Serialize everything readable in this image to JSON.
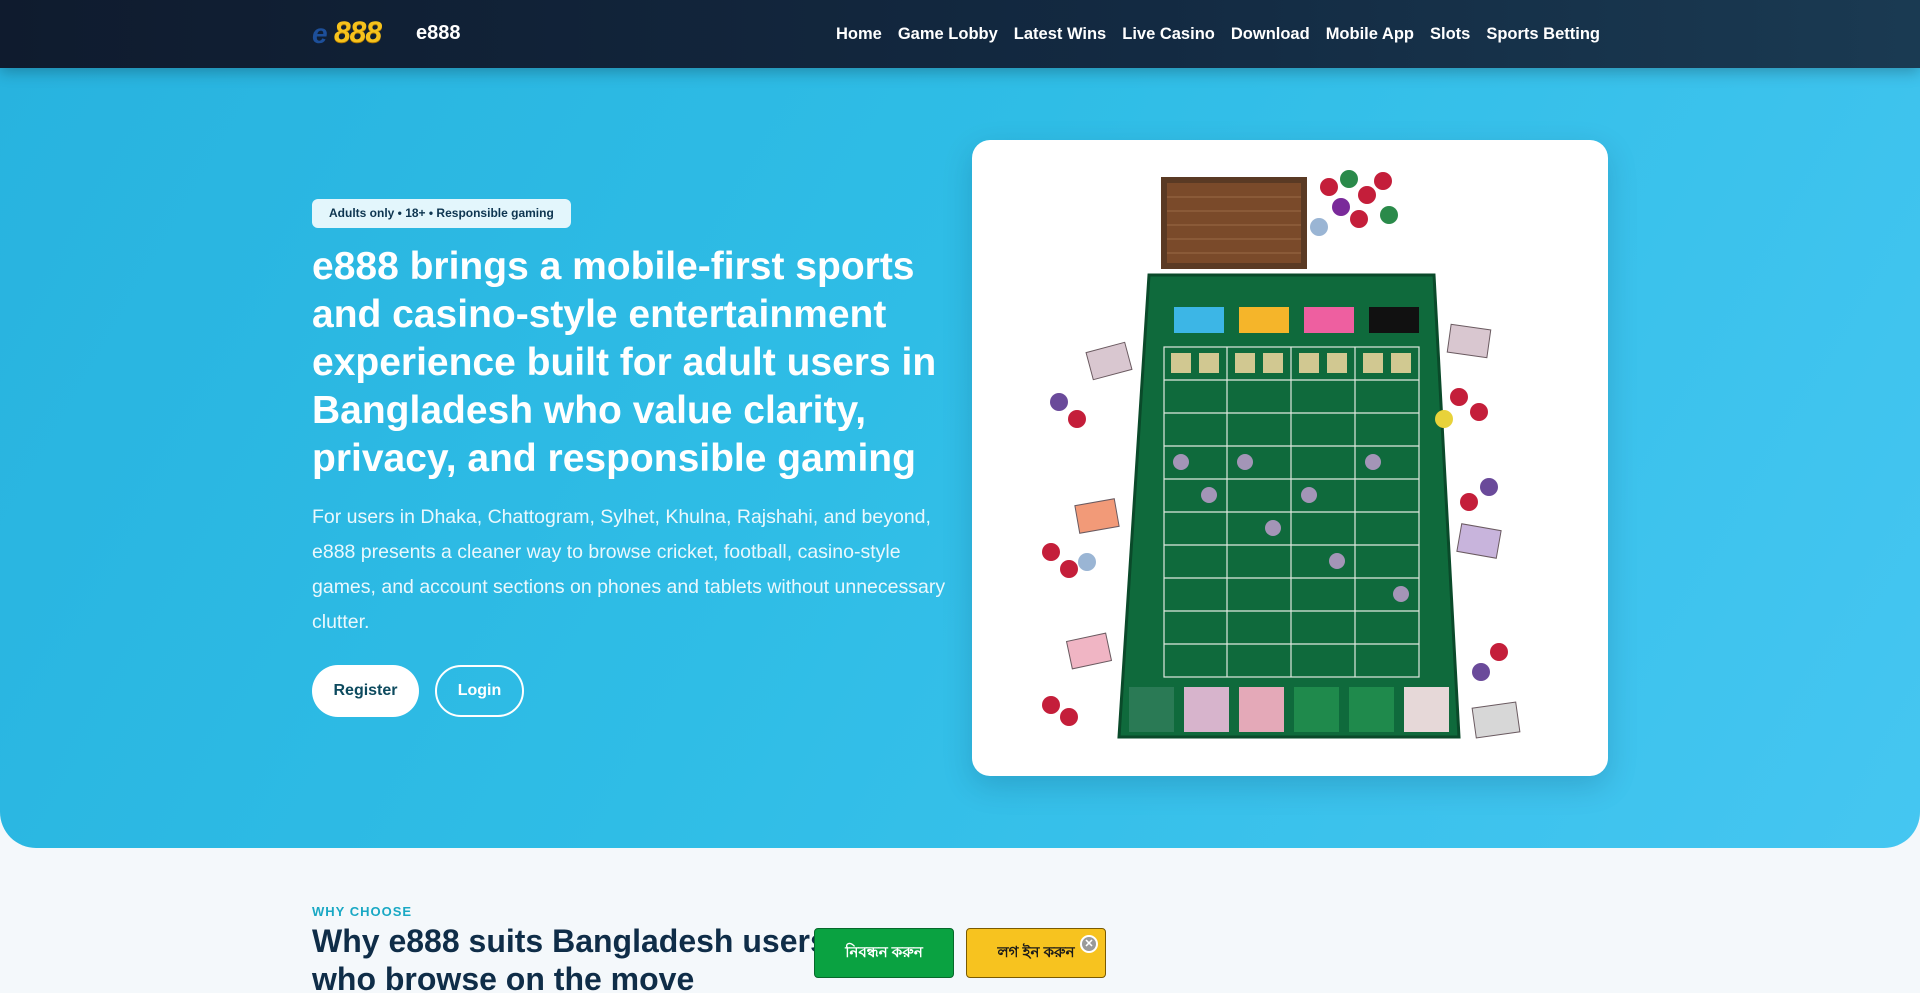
{
  "header": {
    "logo_letter": "e",
    "logo_number": "888",
    "brand_name": "e888",
    "nav": [
      "Home",
      "Game Lobby",
      "Latest Wins",
      "Live Casino",
      "Download",
      "Mobile App",
      "Slots",
      "Sports Betting"
    ]
  },
  "hero": {
    "badge": "Adults only • 18+ • Responsible gaming",
    "title": "e888 brings a mobile-first sports and casino-style entertainment experience built for adult users in Bangladesh who value clarity, privacy, and responsible gaming",
    "subtitle": "For users in Dhaka, Chattogram, Sylhet, Khulna, Rajshahi, and beyond, e888 presents a cleaner way to browse cricket, football, casino-style games, and account sections on phones and tablets without unnecessary clutter.",
    "register_label": "Register",
    "login_label": "Login"
  },
  "why": {
    "kicker": "WHY CHOOSE",
    "title": "Why e888 suits Bangladesh users who browse on the move"
  },
  "sticky": {
    "register_label": "নিবন্ধন করুন",
    "login_label": "লগ ইন করুন",
    "close_symbol": "✕"
  },
  "colors": {
    "header_bg": "#0f1b2e",
    "hero_bg": "#2fbde6",
    "brand_gold": "#f6c21c",
    "register_green": "#0aa241",
    "login_yellow": "#f7c31f",
    "kicker_teal": "#19a8c4"
  }
}
